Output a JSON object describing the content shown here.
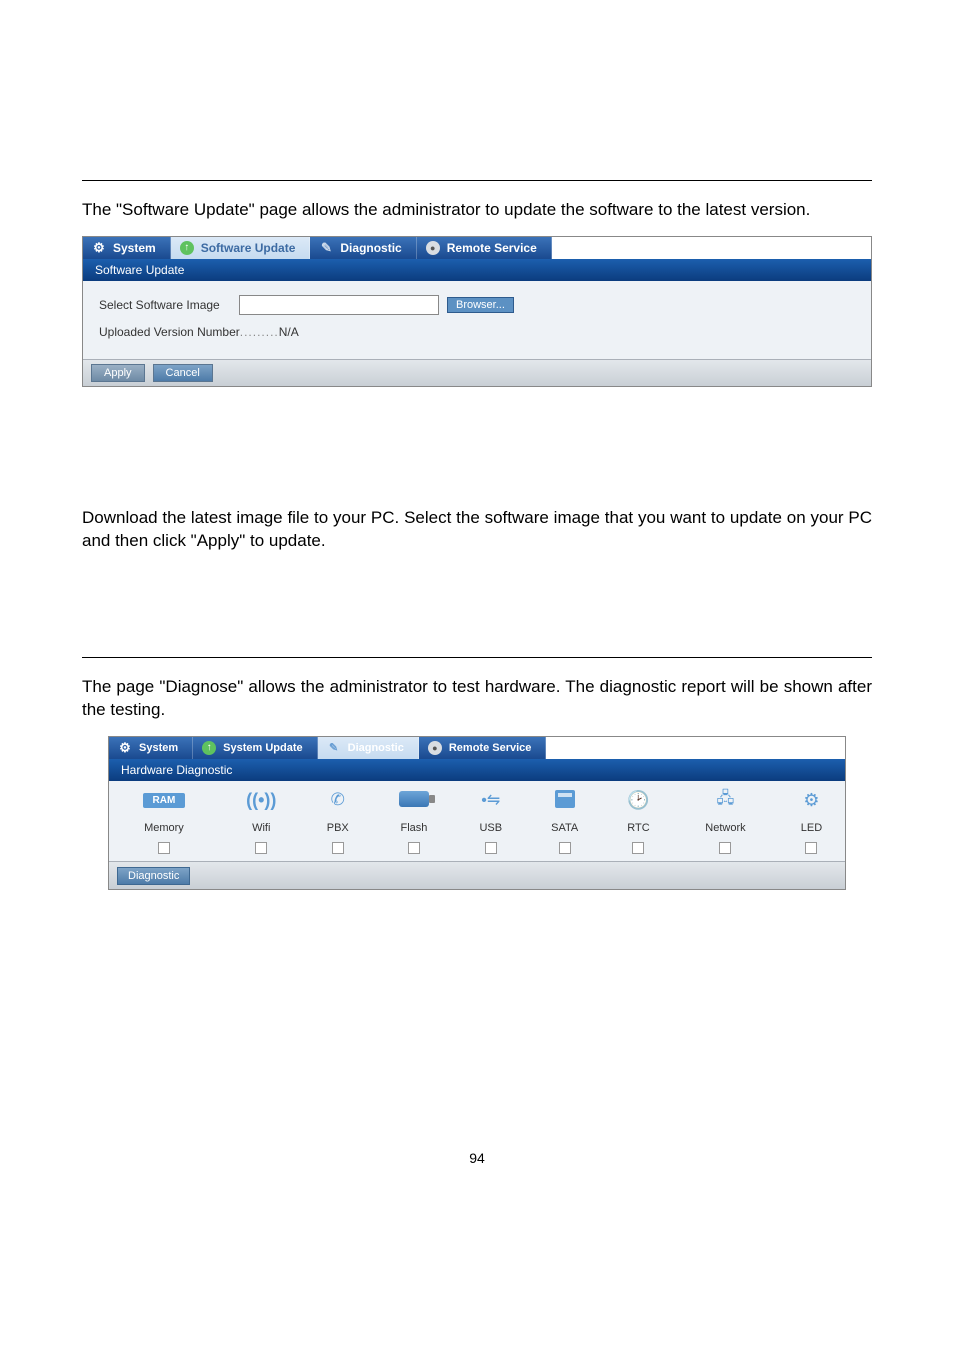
{
  "section1": {
    "intro": "The \"Software Update\" page allows the administrator to update the software to the latest version.",
    "tabs": {
      "system": "System",
      "software_update": "Software Update",
      "diagnostic": "Diagnostic",
      "remote_service": "Remote Service"
    },
    "panel_title": "Software Update",
    "select_label": "Select Software Image",
    "browser_btn": "Browser...",
    "uploaded_label_prefix": "Uploaded Version Number",
    "uploaded_dots": " ......... ",
    "uploaded_value": "N/A",
    "apply_btn": "Apply",
    "cancel_btn": "Cancel",
    "instruction": "Download the latest image file to your PC. Select the software image that you want to update on your PC and then click \"Apply\" to update."
  },
  "section2": {
    "intro": "The page \"Diagnose\" allows the administrator to test hardware. The diagnostic report will be shown after the testing.",
    "tabs": {
      "system": "System",
      "system_update": "System Update",
      "diagnostic": "Diagnostic",
      "remote_service": "Remote Service"
    },
    "panel_title": "Hardware Diagnostic",
    "columns": [
      "Memory",
      "Wifi",
      "PBX",
      "Flash",
      "USB",
      "SATA",
      "RTC",
      "Network",
      "LED"
    ],
    "ram_label": "RAM",
    "diag_btn": "Diagnostic"
  },
  "page_number": "94"
}
